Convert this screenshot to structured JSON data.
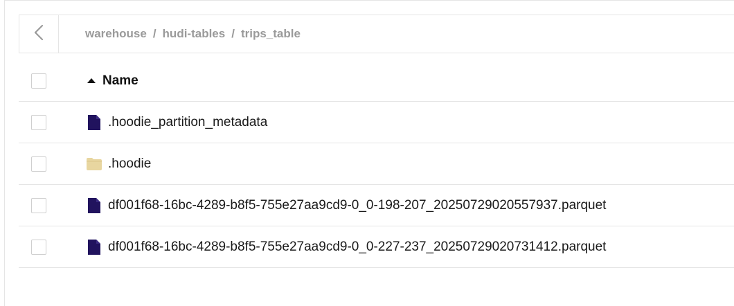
{
  "breadcrumb": {
    "items": [
      "warehouse",
      "hudi-tables",
      "trips_table"
    ],
    "separator": "/"
  },
  "table": {
    "header": {
      "name_label": "Name",
      "sort": "ascending"
    },
    "rows": [
      {
        "name": ".hoodie_partition_metadata",
        "icon": "file-icon"
      },
      {
        "name": ".hoodie",
        "icon": "folder-icon"
      },
      {
        "name": "df001f68-16bc-4289-b8f5-755e27aa9cd9-0_0-198-207_20250729020557937.parquet",
        "icon": "file-icon"
      },
      {
        "name": "df001f68-16bc-4289-b8f5-755e27aa9cd9-0_0-227-237_20250729020731412.parquet",
        "icon": "file-icon"
      }
    ]
  },
  "colors": {
    "file_icon": "#21135e",
    "folder_icon": "#e8d6a0",
    "breadcrumb_text": "#9a9a9a",
    "border": "#e5e5e5"
  }
}
